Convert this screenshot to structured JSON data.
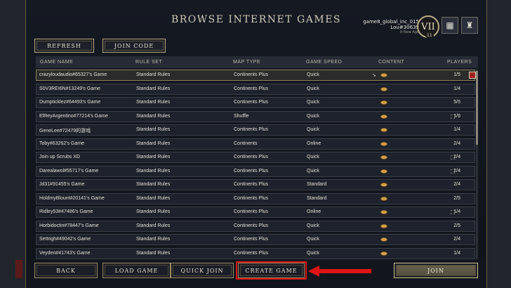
{
  "title": "BROWSE INTERNET GAMES",
  "user": {
    "name": "game8_global_inc_015",
    "tag": "Lou#30639",
    "age": "A New Age",
    "era": "VII",
    "level": "11"
  },
  "header_buttons": [
    "refresh",
    "join_code"
  ],
  "toolbar": {
    "refresh": "REFRESH",
    "join_code": "JOIN CODE"
  },
  "columns": [
    "GAME NAME",
    "RULE SET",
    "MAP TYPE",
    "GAME SPEED",
    "CONTENT",
    "PLAYERS"
  ],
  "rows": [
    {
      "name": "crazyloudaudio#65327's Game",
      "rules": "Standard Rules",
      "map": "Continents Plus",
      "speed": "Quick",
      "players": "1/5",
      "flag": false
    },
    {
      "name": "S0V3REI6N#13249's Game",
      "rules": "Standard Rules",
      "map": "Continents Plus",
      "speed": "Quick",
      "players": "1/4",
      "flag": false
    },
    {
      "name": "Dumpticklez#64493's Game",
      "rules": "Standard Rules",
      "map": "Continents Plus",
      "speed": "Quick",
      "players": "5/5",
      "flag": false
    },
    {
      "name": "ElReyArgentino#77214's Game",
      "rules": "Standard Rules",
      "map": "Shuffle",
      "speed": "Quick",
      "players": "1/6",
      "flag": true
    },
    {
      "name": "GeneLee#72479的游戏",
      "rules": "Standard Rules",
      "map": "Continents Plus",
      "speed": "Quick",
      "players": "1/4",
      "flag": false
    },
    {
      "name": "Toby#63262's Game",
      "rules": "Standard Rules",
      "map": "Continents",
      "speed": "Online",
      "players": "2/4",
      "flag": false
    },
    {
      "name": "Join up Scrubs XD",
      "rules": "Standard Rules",
      "map": "Continents Plus",
      "speed": "Quick",
      "players": "2/4",
      "flag": true
    },
    {
      "name": "Darealawol#55717's Game",
      "rules": "Standard Rules",
      "map": "Continents Plus",
      "speed": "Quick",
      "players": "2/4",
      "flag": true
    },
    {
      "name": "Jd31#91455's Game",
      "rules": "Standard Rules",
      "map": "Continents Plus",
      "speed": "Standard",
      "players": "2/4",
      "flag": false
    },
    {
      "name": "HoldmyBlount#20141's Game",
      "rules": "Standard Rules",
      "map": "Continents Plus",
      "speed": "Standard",
      "players": "2/5",
      "flag": false
    },
    {
      "name": "Ridley53#47486's Game",
      "rules": "Standard Rules",
      "map": "Continents Plus",
      "speed": "Online",
      "players": "1/4",
      "flag": true
    },
    {
      "name": "Horbidoctin#78447's Game",
      "rules": "Standard Rules",
      "map": "Continents Plus",
      "speed": "Quick",
      "players": "2/5",
      "flag": false
    },
    {
      "name": "Settrigh#49042's Game",
      "rules": "Standard Rules",
      "map": "Continents Plus",
      "speed": "Quick",
      "players": "2/4",
      "flag": false
    },
    {
      "name": "Veyden#41743's Game",
      "rules": "Standard Rules",
      "map": "Continents Plus",
      "speed": "Quick",
      "players": "1/4",
      "flag": false
    }
  ],
  "bottom": {
    "back": "BACK",
    "load": "LOAD GAME",
    "quick": "QUICK JOIN",
    "create": "CREATE GAME",
    "join": "JOIN"
  },
  "colors": {
    "highlight": "#e01414",
    "gold": "#b7a57a",
    "content_icon": "#d7a24c"
  }
}
